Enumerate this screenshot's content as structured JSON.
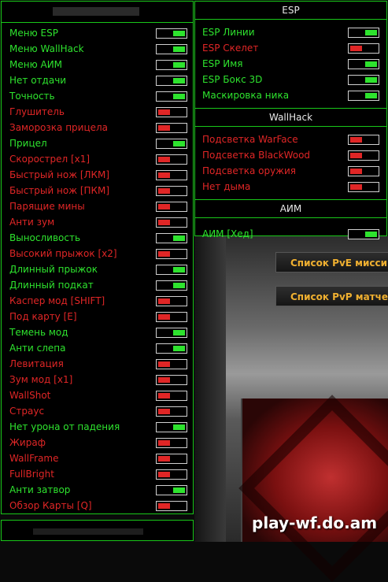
{
  "left_menu": {
    "items": [
      {
        "label": "Меню ESP",
        "on": true
      },
      {
        "label": "Меню WallHack",
        "on": true
      },
      {
        "label": "Меню АИМ",
        "on": true
      },
      {
        "label": "Нет отдачи",
        "on": true
      },
      {
        "label": "Точность",
        "on": true
      },
      {
        "label": "Глушитель",
        "on": false
      },
      {
        "label": "Заморозка прицела",
        "on": false
      },
      {
        "label": "Прицел",
        "on": true
      },
      {
        "label": "Скорострел [x1]",
        "on": false
      },
      {
        "label": "Быстрый нож [ЛКМ]",
        "on": false
      },
      {
        "label": "Быстрый нож [ПКМ]",
        "on": false
      },
      {
        "label": "Парящие мины",
        "on": false
      },
      {
        "label": "Анти зум",
        "on": false
      },
      {
        "label": "Выносливость",
        "on": true
      },
      {
        "label": "Высокий прыжок [x2]",
        "on": false
      },
      {
        "label": "Длинный прыжок",
        "on": true
      },
      {
        "label": "Длинный подкат",
        "on": true
      },
      {
        "label": "Каспер мод [SHIFT]",
        "on": false
      },
      {
        "label": "Под карту [E]",
        "on": false
      },
      {
        "label": "Темень мод",
        "on": true
      },
      {
        "label": "Анти слепа",
        "on": true
      },
      {
        "label": "Левитация",
        "on": false
      },
      {
        "label": "Зум мод [x1]",
        "on": false
      },
      {
        "label": "WallShot",
        "on": false
      },
      {
        "label": "Страус",
        "on": false
      },
      {
        "label": "Нет урона от падения",
        "on": true
      },
      {
        "label": "Жираф",
        "on": false
      },
      {
        "label": "WallFrame",
        "on": false
      },
      {
        "label": "FullBright",
        "on": false
      },
      {
        "label": "Анти затвор",
        "on": true
      },
      {
        "label": "Обзор Карты [Q]",
        "on": false
      }
    ]
  },
  "esp": {
    "title": "ESP",
    "items": [
      {
        "label": "ESP Линии",
        "on": true
      },
      {
        "label": "ESP Скелет",
        "on": false
      },
      {
        "label": "ESP Имя",
        "on": true
      },
      {
        "label": "ESP Бокс 3D",
        "on": true
      },
      {
        "label": "Маскировка ника",
        "on": true
      }
    ]
  },
  "wallhack": {
    "title": "WallHack",
    "items": [
      {
        "label": "Подсветка WarFace",
        "on": false
      },
      {
        "label": "Подсветка BlackWood",
        "on": false
      },
      {
        "label": "Подсветка оружия",
        "on": false
      },
      {
        "label": "Нет дыма",
        "on": false
      }
    ]
  },
  "aim": {
    "title": "АИМ",
    "items": [
      {
        "label": "АИМ [Хед]",
        "on": true
      }
    ]
  },
  "game_menu": {
    "pve_label": "Список PvE миссий",
    "pvp_label": "Список PvP матчей"
  },
  "watermark": "play-wf.do.am",
  "colors": {
    "on": "#2ee32e",
    "off": "#e02626",
    "border": "#19c719"
  }
}
